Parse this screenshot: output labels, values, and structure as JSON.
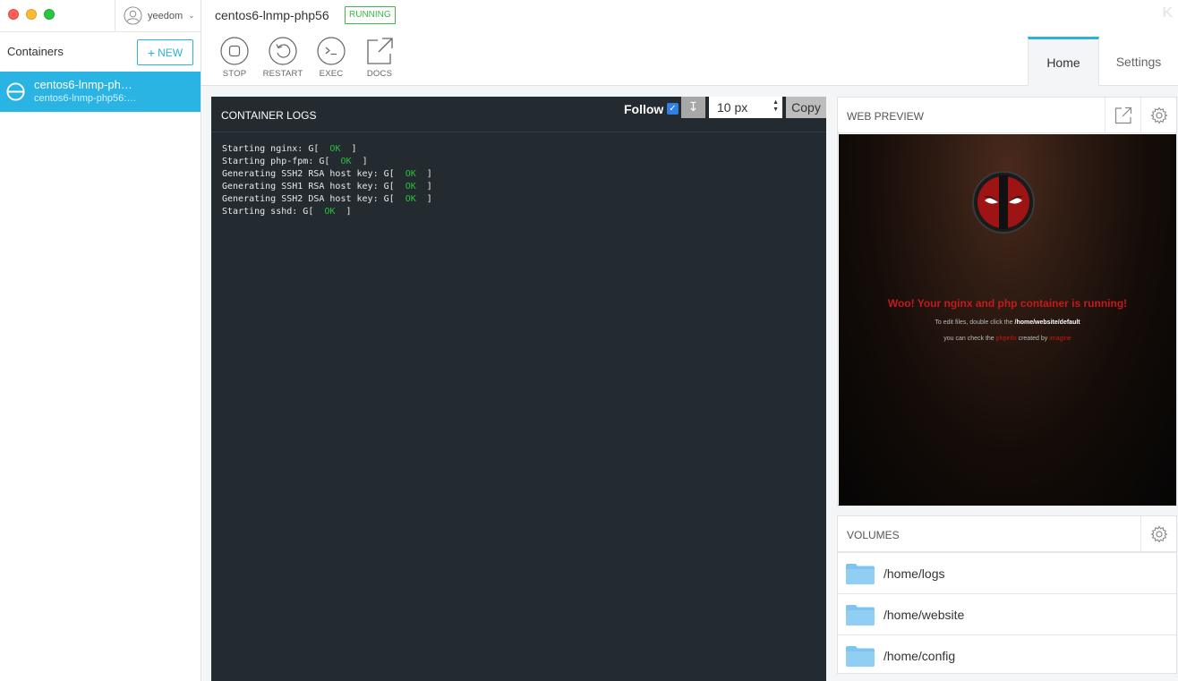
{
  "window": {
    "user": "yeedom"
  },
  "sidebar": {
    "title": "Containers",
    "new_button": "NEW",
    "items": [
      {
        "name": "centos6-lnmp-ph…",
        "image": "centos6-lnmp-php56:…",
        "selected": true
      }
    ]
  },
  "header": {
    "title": "centos6-lnmp-php56",
    "status": "RUNNING",
    "actions": [
      {
        "label": "STOP",
        "icon": "stop-icon"
      },
      {
        "label": "RESTART",
        "icon": "restart-icon"
      },
      {
        "label": "EXEC",
        "icon": "terminal-icon"
      },
      {
        "label": "DOCS",
        "icon": "external-link-icon"
      }
    ],
    "tabs": [
      {
        "label": "Home",
        "active": true
      },
      {
        "label": "Settings",
        "active": false
      }
    ]
  },
  "logs": {
    "title": "CONTAINER LOGS",
    "follow_label": "Follow",
    "follow_checked": true,
    "font_size": "10 px",
    "copy_label": "Copy",
    "lines": [
      {
        "text": "Starting nginx: G[",
        "ok": "OK",
        "end": "]"
      },
      {
        "text": "Starting php-fpm: G[",
        "ok": "OK",
        "end": "]"
      },
      {
        "text": "Generating SSH2 RSA host key: G[",
        "ok": "OK",
        "end": "]"
      },
      {
        "text": "Generating SSH1 RSA host key: G[",
        "ok": "OK",
        "end": "]"
      },
      {
        "text": "Generating SSH2 DSA host key: G[",
        "ok": "OK",
        "end": "]"
      },
      {
        "text": "Starting sshd: G[",
        "ok": "OK",
        "end": "]"
      }
    ]
  },
  "preview": {
    "title": "WEB PREVIEW",
    "headline": "Woo! Your nginx and php container is running!",
    "line1_prefix": "To edit files, double click the",
    "line1_path": "/home/website/default",
    "line2_prefix": "you can check the",
    "line2_link1": "phpinfo",
    "line2_mid": "created by",
    "line2_link2": "imagine"
  },
  "volumes": {
    "title": "VOLUMES",
    "items": [
      {
        "path": "/home/logs"
      },
      {
        "path": "/home/website"
      },
      {
        "path": "/home/config"
      }
    ]
  },
  "colors": {
    "accent": "#29b2dd",
    "selected_bg": "#29b4e4",
    "running": "#3bb84a",
    "log_bg": "#232b30",
    "log_ok": "#2bc03b"
  }
}
